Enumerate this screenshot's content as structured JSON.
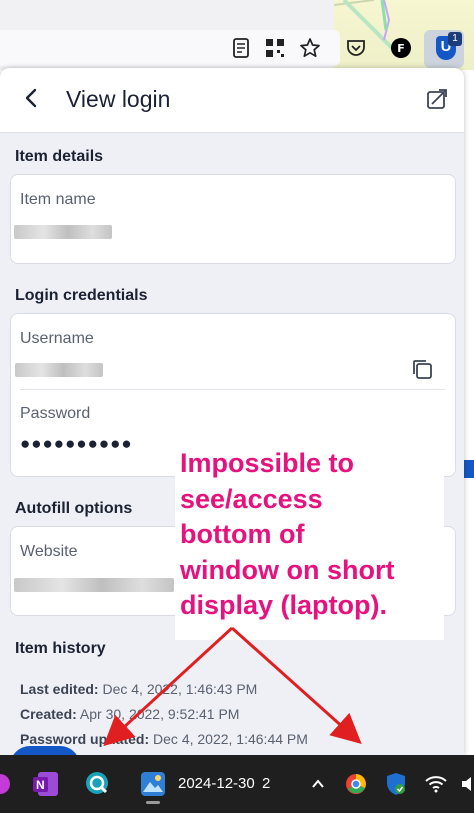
{
  "browser": {
    "avatar_letter": "F",
    "extension_badge": "1",
    "extension_letter": "U"
  },
  "popup": {
    "title": "View login",
    "sections": {
      "item_details": "Item details",
      "login_credentials": "Login credentials",
      "autofill_options": "Autofill options",
      "item_history": "Item history"
    },
    "fields": {
      "item_name_label": "Item name",
      "username_label": "Username",
      "password_label": "Password",
      "password_value": "●●●●●●●●●●",
      "website_label": "Website"
    },
    "history": {
      "last_edited_label": "Last edited:",
      "last_edited_value": "Dec 4, 2022, 1:46:43 PM",
      "created_label": "Created:",
      "created_value": "Apr 30, 2022, 9:52:41 PM",
      "pw_updated_label": "Password updated:",
      "pw_updated_value": "Dec 4, 2022, 1:46:44 PM"
    }
  },
  "annotation": {
    "lines": [
      "Impossible to",
      "see/access",
      "bottom of",
      "window on short",
      "display (laptop)."
    ],
    "color": "#e6127d",
    "arrow_color": "#e02020"
  },
  "taskbar": {
    "date": "2024-12-30",
    "number": "2"
  },
  "colors": {
    "accent": "#1458c8",
    "popup_bg": "#eef0f5"
  }
}
